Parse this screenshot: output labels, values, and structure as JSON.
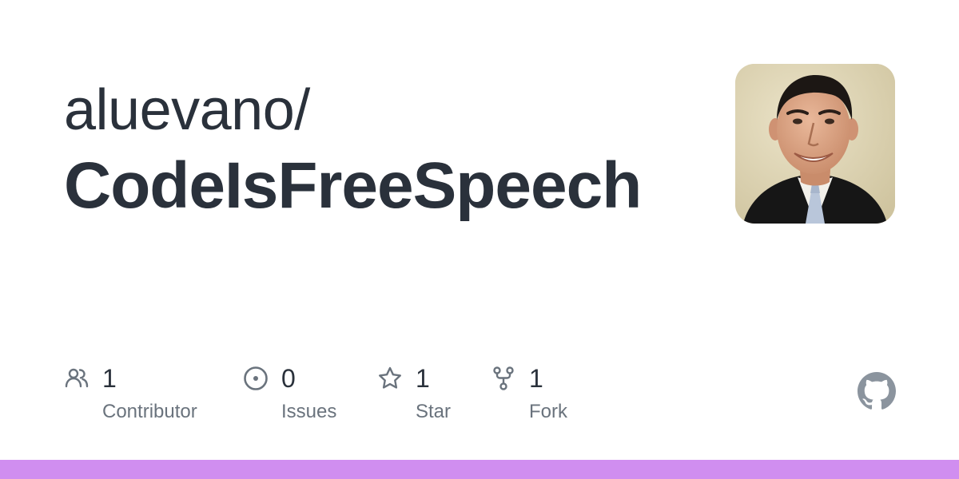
{
  "repo": {
    "owner": "aluevano/",
    "name": "CodeIsFreeSpeech"
  },
  "stats": {
    "contributors": {
      "count": "1",
      "label": "Contributor",
      "icon": "people-icon"
    },
    "issues": {
      "count": "0",
      "label": "Issues",
      "icon": "issue-opened-icon"
    },
    "stars": {
      "count": "1",
      "label": "Star",
      "icon": "star-icon"
    },
    "forks": {
      "count": "1",
      "label": "Fork",
      "icon": "repo-forked-icon"
    }
  },
  "colors": {
    "text_primary": "#2a313b",
    "text_secondary": "#6a737d",
    "icon": "#6a737d",
    "language_bar": "#d08ef0"
  }
}
